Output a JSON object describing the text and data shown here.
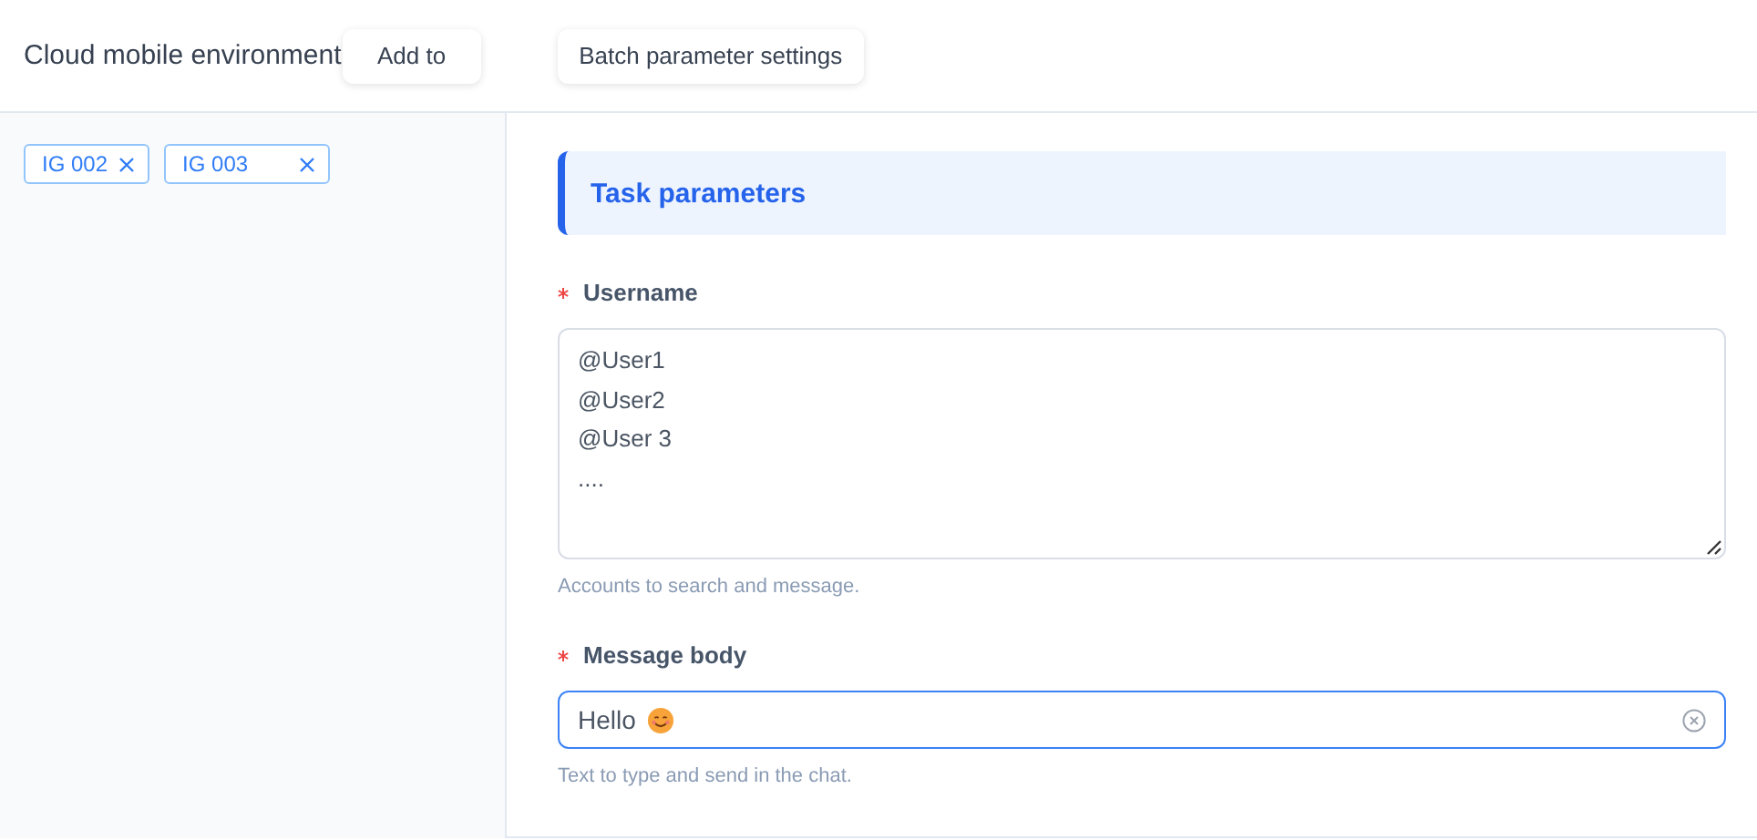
{
  "header": {
    "title": "Cloud mobile environment",
    "buttons": [
      "Add to",
      "Batch parameter settings"
    ]
  },
  "tags": [
    {
      "label": "IG 002",
      "wide": false
    },
    {
      "label": "IG 003",
      "wide": true
    }
  ],
  "section": {
    "title": "Task parameters"
  },
  "fields": [
    {
      "kind": "textarea",
      "label": "Username",
      "required": true,
      "lines": [
        "@User1",
        "@User2",
        "@User 3",
        "...."
      ],
      "help": "Accounts to search and message.",
      "focused": false
    },
    {
      "kind": "input",
      "label": "Message body",
      "required": true,
      "value": "Hello",
      "smiley": true,
      "clearable": true,
      "help": "Text to type and send in the chat.",
      "focused": true
    }
  ]
}
